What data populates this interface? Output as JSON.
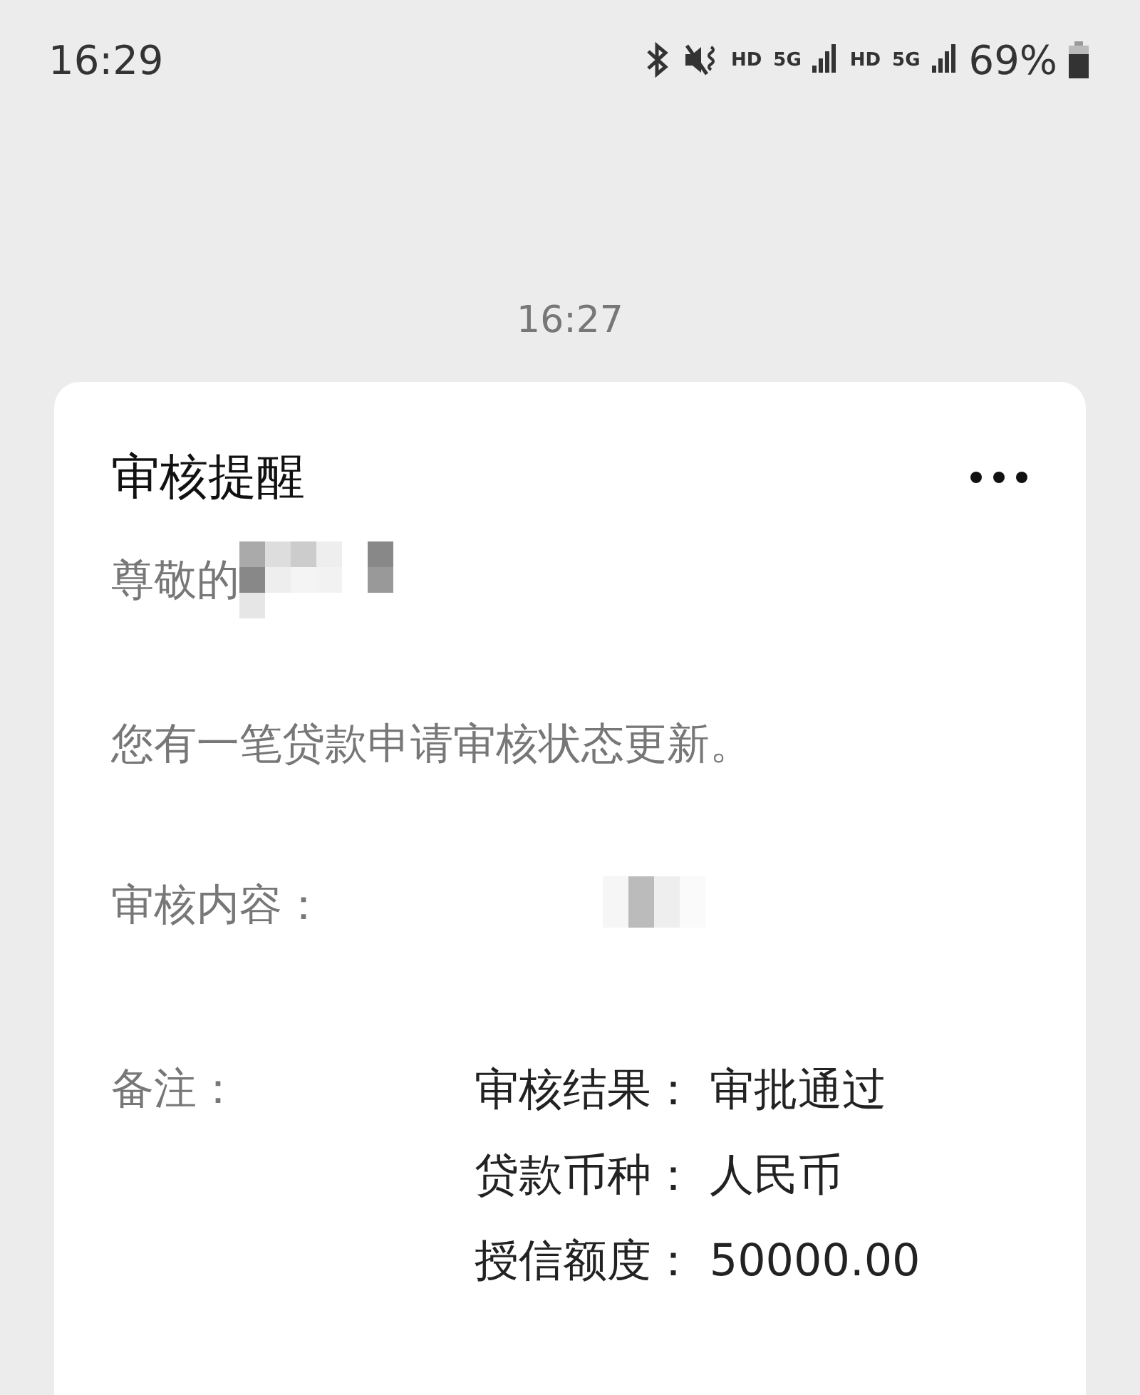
{
  "status_bar": {
    "time": "16:29",
    "items": [
      {
        "kind": "bluetooth"
      },
      {
        "kind": "mute"
      },
      {
        "kind": "label",
        "text": "HD"
      },
      {
        "kind": "signal",
        "text": "5G"
      },
      {
        "kind": "label",
        "text": "HD"
      },
      {
        "kind": "signal",
        "text": "5G"
      }
    ],
    "battery": "69%"
  },
  "timestamp": "16:27",
  "card": {
    "title": "审核提醒",
    "greeting": {
      "text": "尊敬的",
      "redacted": true
    },
    "body": "您有一笔贷款申请审核状态更新。",
    "fields": [
      {
        "label": "审核内容：",
        "redacted": true
      },
      {
        "label": "备注：",
        "lines": [
          {
            "label": "审核结果：",
            "value": "审批通过"
          },
          {
            "label": "贷款币种：",
            "value": "人民币"
          },
          {
            "label": "授信额度：",
            "value": "50000.00"
          }
        ]
      }
    ]
  }
}
